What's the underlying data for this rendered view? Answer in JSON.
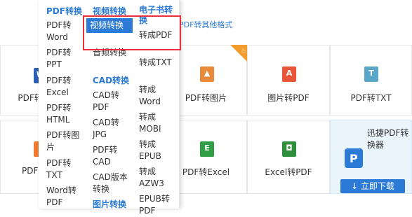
{
  "top_link": "PDF转其他格式",
  "grid": {
    "row1": [
      {
        "label": "PDF转Word",
        "icon": "word-icon",
        "color": "#2b5fb4"
      },
      {
        "label": "PDF转图片",
        "icon": "image-icon",
        "color": "#e88a3a"
      },
      {
        "label": "图片转PDF",
        "icon": "pdf-icon",
        "color": "#e8573a"
      },
      {
        "label": "PDF转TXT",
        "icon": "txt-icon",
        "color": "#5aa7c9"
      }
    ],
    "row2": [
      {
        "label": "PDF",
        "icon": "ppt-icon",
        "color": "#f07a30"
      },
      {
        "label": "PDF转Excel",
        "icon": "excel-icon",
        "color": "#2f9e44"
      },
      {
        "label": "Excel转PDF",
        "icon": "excel-pdf-icon",
        "color": "#2f8f3c"
      }
    ],
    "hot_badge_color": "#f39c2b"
  },
  "promo": {
    "text": "迅捷PDF转换器",
    "download": "↓ 立即下载"
  },
  "menu": {
    "col1": {
      "header": "PDF转换",
      "items": [
        "PDF转Word",
        "PDF转PPT",
        "PDF转Excel",
        "PDF转HTML",
        "PDF转图片",
        "PDF转TXT",
        "Word转PDF"
      ]
    },
    "col2": {
      "header": "视频转换",
      "items_a": [
        "视频转换",
        "音频转换"
      ],
      "header_b": "CAD转换",
      "items_b": [
        "CAD转PDF",
        "CAD转JPG",
        "PDF转CAD",
        "CAD版本转换"
      ],
      "header_c": "图片转换"
    },
    "col3": {
      "header": "电子书转换",
      "items": [
        "转成PDF",
        "转成TXT",
        "转成Word",
        "转成MOBI",
        "转成EPUB",
        "转成AZW3",
        "EPUB转PDF"
      ]
    }
  },
  "colors": {
    "accent": "#2b7bd6",
    "highlight_box": "#e8303a"
  }
}
